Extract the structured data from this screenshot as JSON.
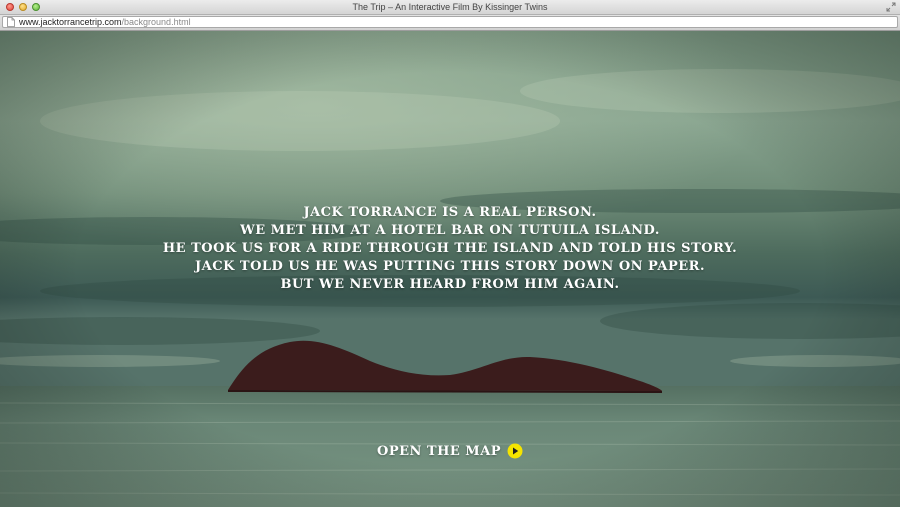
{
  "window": {
    "title": "The Trip – An Interactive Film By Kissinger Twins"
  },
  "urlbar": {
    "domain": "www.jacktorrancetrip.com",
    "path": "/background.html"
  },
  "story": {
    "lines": [
      "JACK TORRANCE IS A REAL PERSON.",
      "WE MET HIM AT A HOTEL BAR ON TUTUILA ISLAND.",
      "HE TOOK US FOR A RIDE THROUGH THE ISLAND AND TOLD HIS STORY.",
      "JACK TOLD US HE WAS PUTTING THIS STORY DOWN ON PAPER.",
      "BUT WE NEVER HEARD FROM HIM AGAIN."
    ]
  },
  "cta": {
    "label": "OPEN THE MAP",
    "icon": "play-circle-icon",
    "icon_color": "#f5e400"
  },
  "colors": {
    "sky": "#6f8c78",
    "sea": "#6e8a7a",
    "island": "#3b1c1c",
    "text": "#ffffff"
  }
}
